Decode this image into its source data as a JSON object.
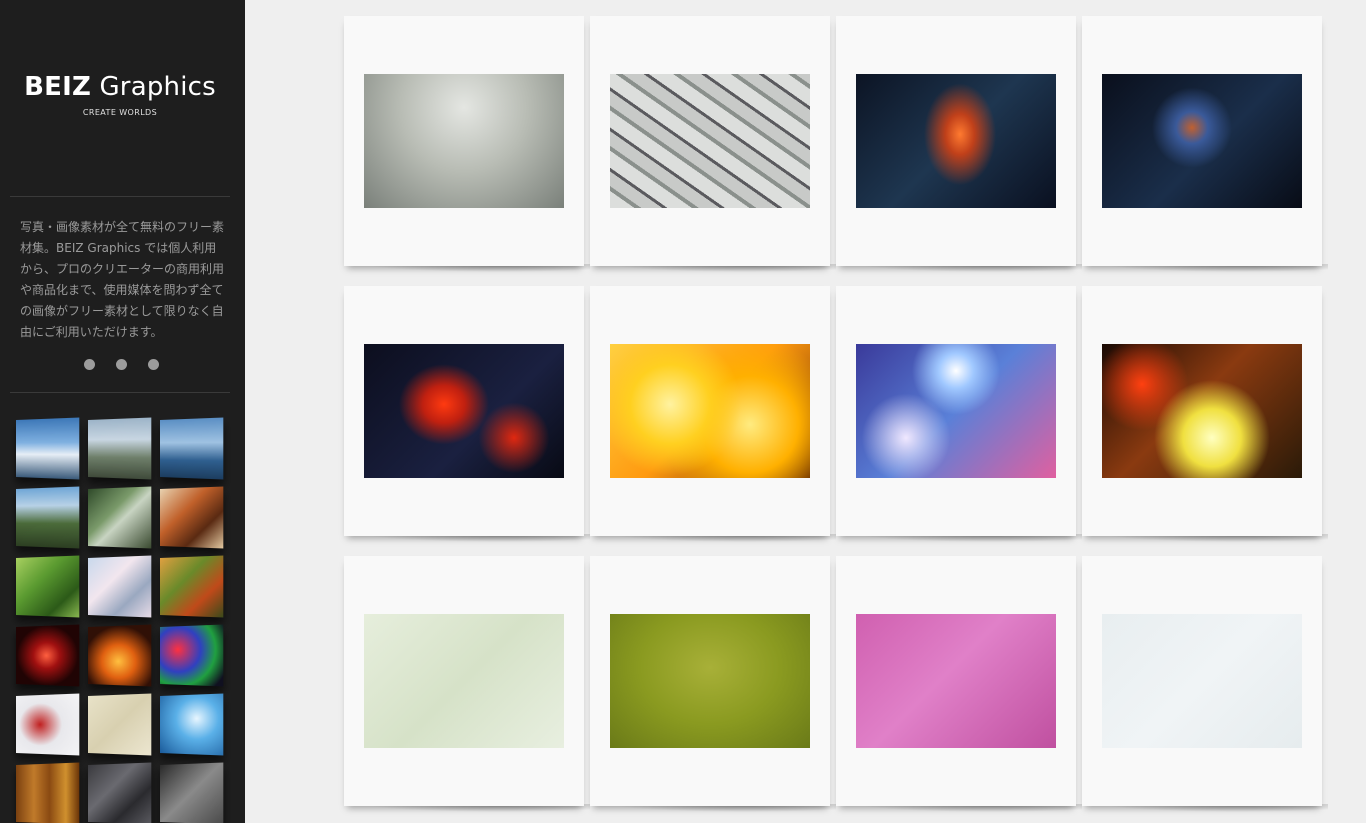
{
  "brand": {
    "title_bold": "BEIZ",
    "title_rest": " Graphics",
    "tagline": "CREATE WORLDS"
  },
  "intro_text": "写真・画像素材が全て無料のフリー素材集。BEIZ Graphics では個人利用から、プロのクリエーターの商用利用や商品化まで、使用媒体を問わず全ての画像がフリー素材として限りなく自由にご利用いただけます。",
  "slider_dots": [
    "dot-1",
    "dot-2",
    "dot-3"
  ],
  "sidebar_thumbnails": [
    {
      "name": "thumb-sky-clouds",
      "bg": "linear-gradient(180deg,#3d78b8 0%,#7fb0e0 40%,#e6eef6 60%,#3a5a7a 100%)"
    },
    {
      "name": "thumb-mountain",
      "bg": "linear-gradient(180deg,#9db4c8 0%,#c8d6e2 35%,#6e7f6a 65%,#3f4a3a 100%)"
    },
    {
      "name": "thumb-ocean",
      "bg": "linear-gradient(180deg,#5b8fc4 0%,#9fc2e2 40%,#2f5f8f 70%,#1c3d5f 100%)"
    },
    {
      "name": "thumb-valley",
      "bg": "linear-gradient(180deg,#6fa6d6 0%,#b7d1e6 30%,#4b6b3a 60%,#2c3e22 100%)"
    },
    {
      "name": "thumb-stream",
      "bg": "linear-gradient(135deg,#2f4a2a 0%,#7a9a6a 40%,#c8d4c2 55%,#3a4a30 100%)"
    },
    {
      "name": "thumb-autumn-tree",
      "bg": "linear-gradient(135deg,#e8d2b0 0%,#c0602a 40%,#5a2a12 70%,#e2c8a0 100%)"
    },
    {
      "name": "thumb-green-leaves",
      "bg": "linear-gradient(135deg,#a8d060 0%,#5a9a30 40%,#2c5a18 75%,#8ab850 100%)"
    },
    {
      "name": "thumb-cherry-blossom",
      "bg": "linear-gradient(135deg,#c8d8ec 0%,#f2e6ee 40%,#9aa8c0 70%,#e8dce8 100%)"
    },
    {
      "name": "thumb-maple",
      "bg": "linear-gradient(135deg,#e0a040 0%,#6a8a2a 40%,#c04a1a 70%,#3a4a1a 100%)"
    },
    {
      "name": "thumb-fireworks",
      "bg": "radial-gradient(circle at 50% 50%,#ff6040 0%,#a01010 30%,#200404 70%)"
    },
    {
      "name": "thumb-fire",
      "bg": "radial-gradient(circle at 50% 60%,#ffc040 0%,#e06010 35%,#301006 75%)"
    },
    {
      "name": "thumb-bokeh-color",
      "bg": "radial-gradient(circle at 30% 40%,#ff3040 0%,#3040c0 40%,#20a040 65%,#101020 90%)"
    },
    {
      "name": "thumb-paint-splash",
      "bg": "radial-gradient(circle at 40% 50%,#c02020 0%,#e8e8ec 45%,#f4f4f6 100%)"
    },
    {
      "name": "thumb-paper-beige",
      "bg": "linear-gradient(135deg,#e8e2c8 0%,#d8d0b0 50%,#ece6d0 100%)"
    },
    {
      "name": "thumb-blue-glow",
      "bg": "radial-gradient(circle at 60% 40%,#e8f6ff 0%,#5ab0e8 40%,#1a5a9a 100%)"
    },
    {
      "name": "thumb-wood",
      "bg": "linear-gradient(90deg,#7a4010 0%,#c07a2a 30%,#8a4a12 55%,#d0902e 80%,#6a3408 100%)"
    },
    {
      "name": "thumb-stone",
      "bg": "linear-gradient(135deg,#3a3a3e 0%,#6a6a70 40%,#2a2a2e 70%,#5a5a60 100%)"
    },
    {
      "name": "thumb-gray",
      "bg": "linear-gradient(135deg,#2a2a2a 0%,#8a8a8a 50%,#4a4a4a 100%)"
    }
  ],
  "gallery": [
    {
      "name": "photo-cubes-runner",
      "bg": "radial-gradient(ellipse at 50% 25%,#e4e6e2 0%,#b8bcb4 45%,#7a807a 100%)"
    },
    {
      "name": "photo-cubes-topdown",
      "bg": "repeating-linear-gradient(35deg,#dcdedc 0 14px,#8a908c 14px 18px,#c8cac8 18px 30px,#5a5a5e 30px 33px)"
    },
    {
      "name": "photo-nebula-orange",
      "bg": "radial-gradient(ellipse 18% 38% at 52% 45%,#ff7a30 0%,#c0401a 40%,rgba(20,40,70,0) 100%),linear-gradient(135deg,#0c1424 0%,#1e3650 50%,#0a1020 100%)"
    },
    {
      "name": "photo-nebula-blue",
      "bg": "radial-gradient(ellipse 20% 30% at 45% 40%,#c06030 0%,#3a5a9a 40%,rgba(10,20,40,0) 100%),linear-gradient(135deg,#0a0f1c 0%,#1a2e4a 55%,#080c16 100%)"
    },
    {
      "name": "photo-nebula-red",
      "bg": "radial-gradient(ellipse 30% 40% at 40% 45%,#ff3a10 0%,#c02010 35%,rgba(10,10,30,0) 75%),radial-gradient(circle at 75% 70%,#e02810 0%,rgba(0,0,0,0) 20%),linear-gradient(135deg,#0c0e1e 0%,#1a2040 60%,#080a14 100%)"
    },
    {
      "name": "photo-bokeh-yellow",
      "bg": "radial-gradient(circle at 30% 45%,#fff2a0 0%,#ffd020 25%,rgba(255,200,0,0) 45%),radial-gradient(circle at 70% 60%,#ffeb80 0%,#ffb000 30%,rgba(200,80,0,0) 55%),linear-gradient(135deg,#ffd040 0%,#ff9a10 50%,#5a2000 100%)"
    },
    {
      "name": "photo-bokeh-blue",
      "bg": "radial-gradient(circle at 50% 20%,#ffffff 0%,#a0c8ff 12%,rgba(60,90,200,0) 30%),radial-gradient(circle at 25% 70%,#f0e8ff 0%,rgba(160,120,220,0) 25%),linear-gradient(135deg,#3a3a9a 0%,#5a80d8 50%,#e060a0 100%)"
    },
    {
      "name": "photo-bokeh-warm",
      "bg": "radial-gradient(circle at 55% 70%,#ffffc0 0%,#f0e040 20%,rgba(200,140,20,0) 40%),radial-gradient(circle at 20% 30%,#ff4010 0%,rgba(200,40,0,0) 25%),linear-gradient(135deg,#1a0a04 0%,#8a3a10 45%,#2a1a08 100%)"
    },
    {
      "name": "photo-washi-green",
      "bg": "linear-gradient(135deg,#e6eedc 0%,#d6e2c8 50%,#e8efe0 100%)"
    },
    {
      "name": "photo-grass-olive",
      "bg": "radial-gradient(ellipse at 50% 40%,#a8b038 0%,#8a9a20 50%,#6a7a18 100%)"
    },
    {
      "name": "photo-washi-pink",
      "bg": "linear-gradient(135deg,#d060b0 0%,#e080c8 45%,#c050a0 100%)"
    },
    {
      "name": "photo-paper-white",
      "bg": "linear-gradient(135deg,#e8eef0 0%,#f0f4f6 50%,#e6ecee 100%)"
    }
  ]
}
